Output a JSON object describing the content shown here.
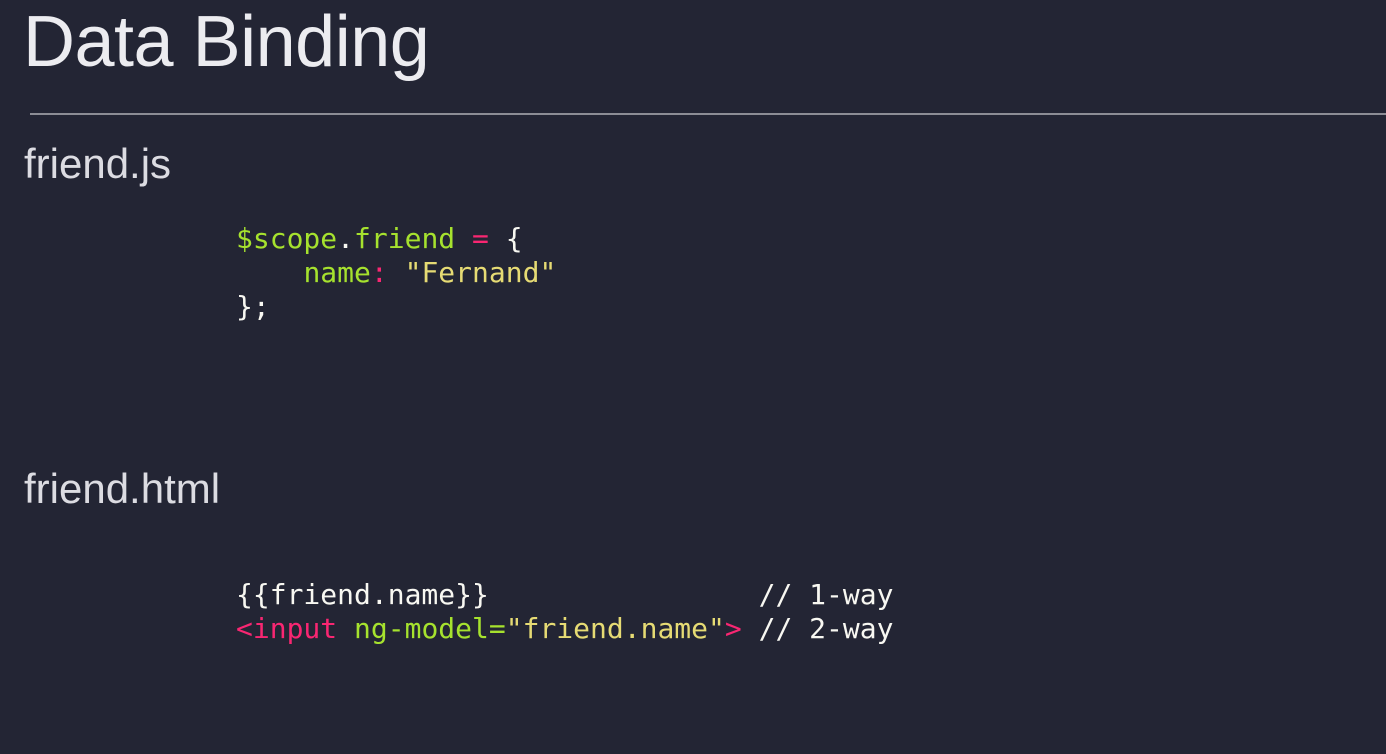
{
  "slide": {
    "title": "Data Binding",
    "colors": {
      "background": "#232534",
      "title": "#ececf0",
      "rule": "#8c8d95",
      "code_default": "#f8f8f2",
      "code_keyword_green": "#a6e22e",
      "code_operator_pink": "#f92672",
      "code_string_yellow": "#e6db74"
    },
    "sections": [
      {
        "heading": "friend.js",
        "code_lines": [
          {
            "tokens": [
              {
                "text": "$scope",
                "kind": "var"
              },
              {
                "text": ".",
                "kind": "punct"
              },
              {
                "text": "friend",
                "kind": "var"
              },
              {
                "text": " ",
                "kind": "plain"
              },
              {
                "text": "=",
                "kind": "op"
              },
              {
                "text": " {",
                "kind": "punct"
              }
            ]
          },
          {
            "tokens": [
              {
                "text": "    ",
                "kind": "plain"
              },
              {
                "text": "name",
                "kind": "key"
              },
              {
                "text": ":",
                "kind": "op"
              },
              {
                "text": " ",
                "kind": "plain"
              },
              {
                "text": "\"Fernand\"",
                "kind": "str"
              }
            ]
          },
          {
            "tokens": [
              {
                "text": "};",
                "kind": "punct"
              }
            ]
          }
        ]
      },
      {
        "heading": "friend.html",
        "code_lines": [
          {
            "tokens": [
              {
                "text": "{{friend.name}}",
                "kind": "plain"
              },
              {
                "text": "                ",
                "kind": "plain"
              },
              {
                "text": "// 1-way",
                "kind": "plain"
              }
            ]
          },
          {
            "tokens": [
              {
                "text": "<input",
                "kind": "tag"
              },
              {
                "text": " ",
                "kind": "plain"
              },
              {
                "text": "ng-model",
                "kind": "attr"
              },
              {
                "text": "=",
                "kind": "attr"
              },
              {
                "text": "\"friend.name\"",
                "kind": "str"
              },
              {
                "text": ">",
                "kind": "tag"
              },
              {
                "text": " ",
                "kind": "plain"
              },
              {
                "text": "// 2-way",
                "kind": "plain"
              }
            ]
          }
        ]
      }
    ]
  }
}
